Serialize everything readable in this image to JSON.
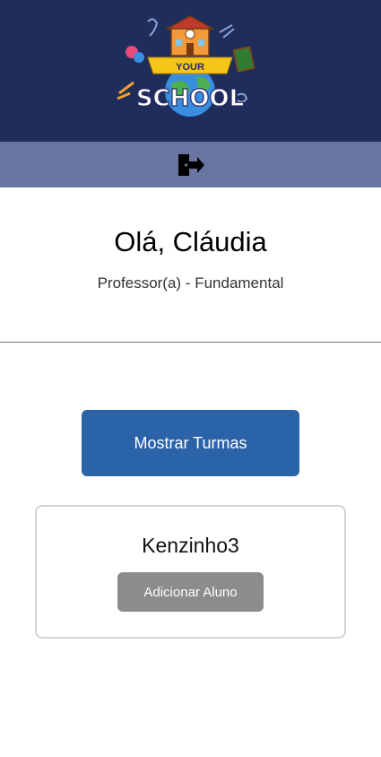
{
  "header": {
    "logo_text_top": "YOUR",
    "logo_text_bottom": "SCHOOL",
    "background": "#1f2d5a"
  },
  "logout_bar": {
    "icon": "logout-door-icon",
    "background": "#6975a0"
  },
  "profile": {
    "greeting": "Olá, Cláudia",
    "role": "Professor(a) - Fundamental"
  },
  "actions": {
    "show_classes_label": "Mostrar Turmas",
    "accent": "#2b63a8"
  },
  "classes": [
    {
      "name": "Kenzinho3",
      "add_student_label": "Adicionar Aluno"
    }
  ]
}
